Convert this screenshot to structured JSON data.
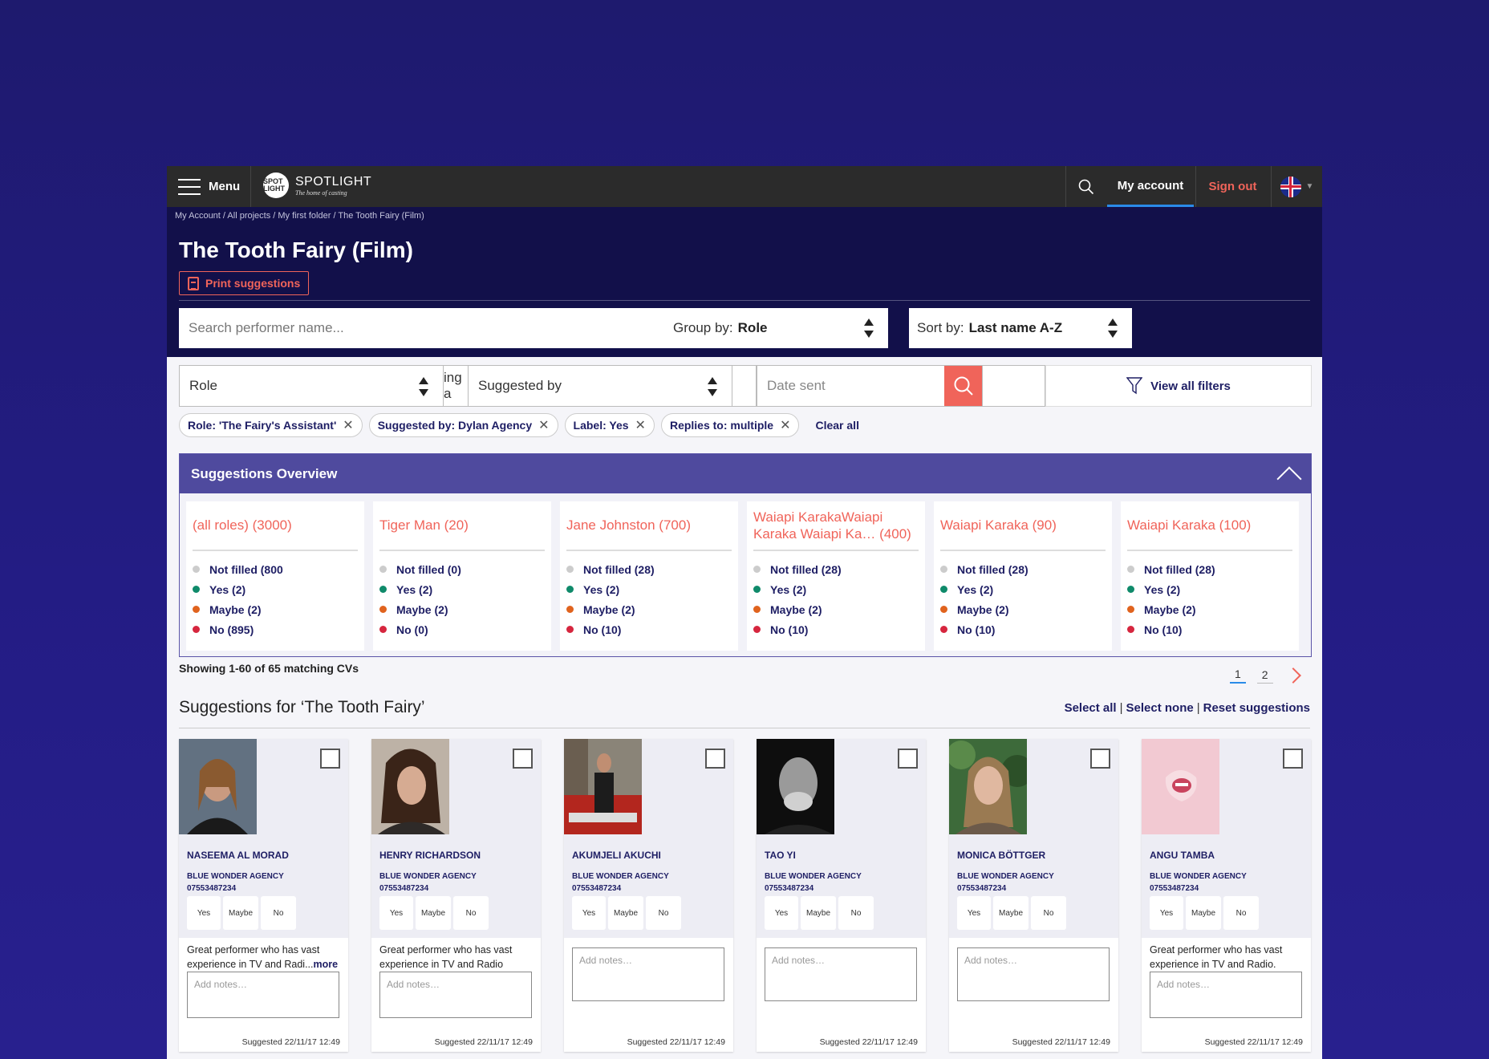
{
  "topbar": {
    "menu_label": "Menu",
    "logo_mark": "SPOT LIGHT",
    "logo_text": "SPOTLIGHT",
    "logo_tagline": "The home of casting",
    "account_label": "My account",
    "signout_label": "Sign out",
    "accent_color": "#2a8be8",
    "signout_color": "#f0645a"
  },
  "header": {
    "breadcrumb": "My Account / All projects / My first folder / The Tooth Fairy (Film)",
    "title": "The Tooth Fairy (Film)",
    "print_label": "Print suggestions",
    "search_placeholder": "Search performer name...",
    "group_by_label": "Group by:",
    "group_by_value": "Role",
    "sort_by_label": "Sort by:",
    "sort_by_value": "Last name A-Z"
  },
  "filters": {
    "role_value": "Role",
    "hidden_fragment": "ing a",
    "suggested_by_value": "Suggested by",
    "date_placeholder": "Date sent",
    "view_all_label": "View all filters",
    "chips": [
      {
        "label": "Role: 'The Fairy's Assistant'"
      },
      {
        "label": "Suggested by: Dylan Agency"
      },
      {
        "label": "Label: Yes"
      },
      {
        "label": "Replies to: multiple"
      }
    ],
    "chip_close": "✕",
    "clear_all_label": "Clear all"
  },
  "overview": {
    "title": "Suggestions Overview",
    "status_colors": {
      "not_filled": "#cccccc",
      "yes": "#0f8a6a",
      "maybe": "#e0631e",
      "no": "#d6263e"
    },
    "columns": [
      {
        "title": "(all roles) (3000)",
        "not_filled": "Not filled (800",
        "yes": "Yes (2)",
        "maybe": "Maybe (2)",
        "no": "No (895)"
      },
      {
        "title": "Tiger Man (20)",
        "not_filled": "Not filled (0)",
        "yes": "Yes (2)",
        "maybe": "Maybe (2)",
        "no": "No (0)"
      },
      {
        "title": "Jane Johnston (700)",
        "not_filled": "Not filled (28)",
        "yes": "Yes (2)",
        "maybe": "Maybe (2)",
        "no": "No (10)"
      },
      {
        "title": "Waiapi KarakaWaiapi Karaka Waiapi Ka… (400)",
        "not_filled": "Not filled (28)",
        "yes": "Yes (2)",
        "maybe": "Maybe (2)",
        "no": "No (10)"
      },
      {
        "title": "Waiapi Karaka (90)",
        "not_filled": "Not filled (28)",
        "yes": "Yes (2)",
        "maybe": "Maybe (2)",
        "no": "No (10)"
      },
      {
        "title": "Waiapi Karaka (100)",
        "not_filled": "Not filled (28)",
        "yes": "Yes (2)",
        "maybe": "Maybe (2)",
        "no": "No (10)"
      }
    ]
  },
  "results": {
    "showing": "Showing 1-60 of 65 matching CVs",
    "pages": [
      "1",
      "2"
    ],
    "current_page": "1",
    "section_title": "Suggestions for ‘The Tooth Fairy’",
    "select_all": "Select all",
    "select_none": "Select none",
    "reset": "Reset suggestions",
    "separator": "|"
  },
  "cards": [
    {
      "name": "NASEEMA AL MORAD",
      "agency": "BLUE WONDER AGENCY",
      "phone": "07553487234",
      "yes": "Yes",
      "maybe": "Maybe",
      "no": "No",
      "desc": "Great performer who has vast experience in TV and Radi...",
      "more": "more",
      "notes_placeholder": "Add notes…",
      "stamp": "Suggested 22/11/17 12:49"
    },
    {
      "name": "HENRY RICHARDSON",
      "agency": "BLUE WONDER AGENCY",
      "phone": "07553487234",
      "yes": "Yes",
      "maybe": "Maybe",
      "no": "No",
      "desc": "Great performer who has vast experience in TV and Radio",
      "notes_placeholder": "Add notes…",
      "stamp": "Suggested 22/11/17 12:49"
    },
    {
      "name": "AKUMJELI AKUCHI",
      "agency": "BLUE WONDER AGENCY",
      "phone": "07553487234",
      "yes": "Yes",
      "maybe": "Maybe",
      "no": "No",
      "notes_placeholder": "Add notes…",
      "stamp": "Suggested 22/11/17 12:49"
    },
    {
      "name": "TAO YI",
      "agency": "BLUE WONDER AGENCY",
      "phone": "07553487234",
      "yes": "Yes",
      "maybe": "Maybe",
      "no": "No",
      "notes_placeholder": "Add notes…",
      "stamp": "Suggested 22/11/17 12:49"
    },
    {
      "name": "MONICA BÖTTGER",
      "agency": "BLUE WONDER AGENCY",
      "phone": "07553487234",
      "yes": "Yes",
      "maybe": "Maybe",
      "no": "No",
      "notes_placeholder": "Add notes…",
      "stamp": "Suggested 22/11/17 12:49"
    },
    {
      "name": "ANGU TAMBA",
      "agency": "BLUE WONDER AGENCY",
      "phone": "07553487234",
      "yes": "Yes",
      "maybe": "Maybe",
      "no": "No",
      "desc": "Great performer who has vast experience in TV and Radio.",
      "notes_placeholder": "Add notes…",
      "stamp": "Suggested 22/11/17 12:49"
    }
  ]
}
